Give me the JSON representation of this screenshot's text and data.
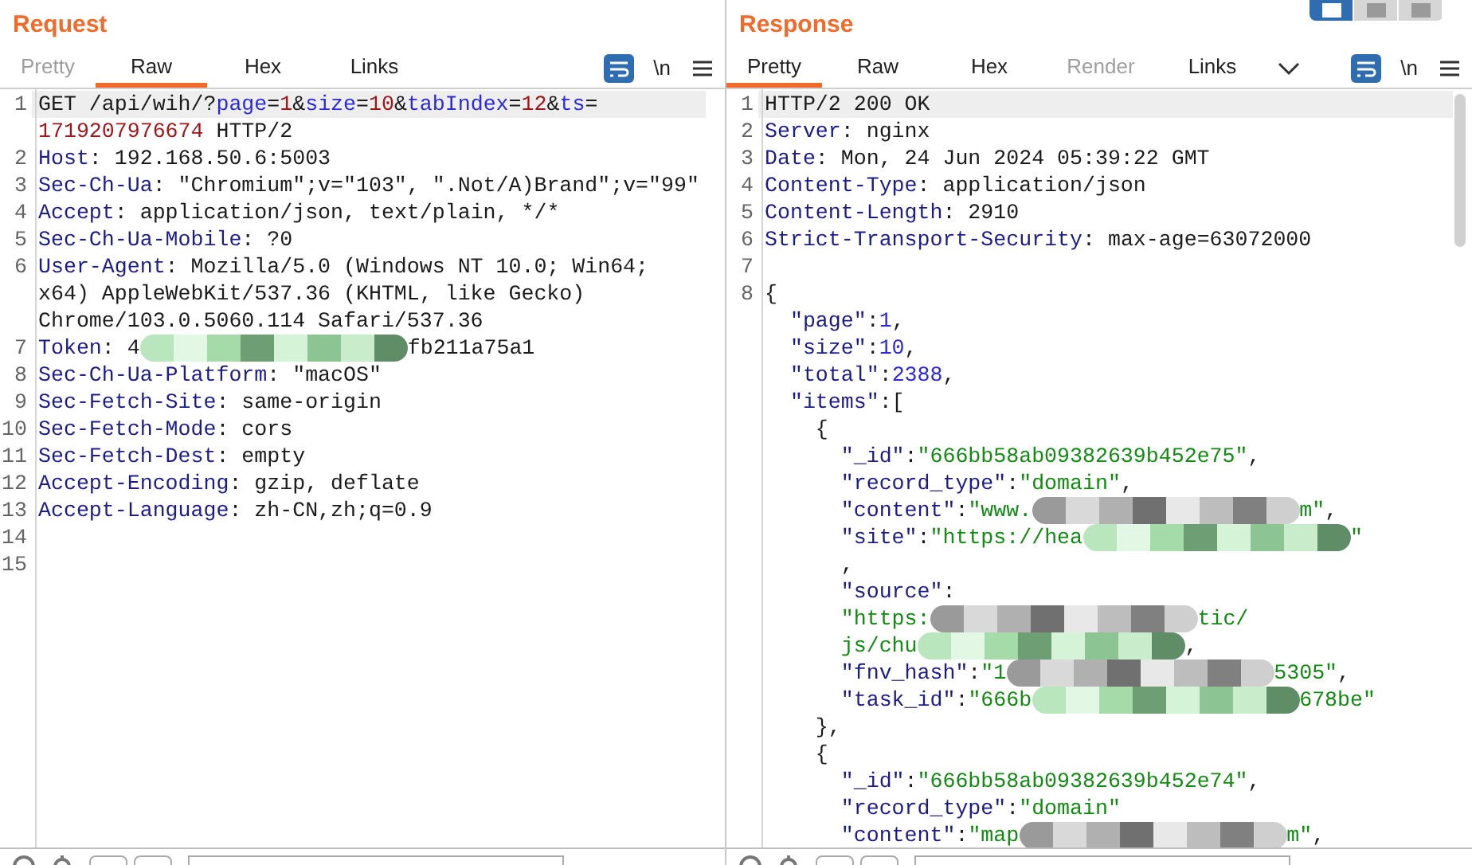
{
  "layout_buttons": [
    {
      "selected": true
    },
    {
      "selected": false
    },
    {
      "selected": false
    }
  ],
  "panes": [
    {
      "title": "Request",
      "tabs": [
        {
          "label": "Pretty",
          "selected": false,
          "disabled": true
        },
        {
          "label": "Raw",
          "selected": true,
          "disabled": false
        },
        {
          "label": "Hex",
          "selected": false,
          "disabled": false
        },
        {
          "label": "Links",
          "selected": false,
          "disabled": false
        }
      ],
      "more_tabs": false,
      "wrap_label": "\\n",
      "lines": [
        {
          "number": "1",
          "highlighted": true,
          "tokens": [
            {
              "kind": "plain",
              "text": "GET /api/wih/?"
            },
            {
              "kind": "param",
              "text": "page"
            },
            {
              "kind": "plain",
              "text": "="
            },
            {
              "kind": "num",
              "text": "1"
            },
            {
              "kind": "plain",
              "text": "&"
            },
            {
              "kind": "param",
              "text": "size"
            },
            {
              "kind": "plain",
              "text": "="
            },
            {
              "kind": "num",
              "text": "10"
            },
            {
              "kind": "plain",
              "text": "&"
            },
            {
              "kind": "param",
              "text": "tabIndex"
            },
            {
              "kind": "plain",
              "text": "="
            },
            {
              "kind": "num",
              "text": "12"
            },
            {
              "kind": "plain",
              "text": "&"
            },
            {
              "kind": "param",
              "text": "ts"
            },
            {
              "kind": "plain",
              "text": "="
            }
          ]
        },
        {
          "highlighted": false,
          "tokens": [
            {
              "kind": "num",
              "text": "1719207976674"
            },
            {
              "kind": "plain",
              "text": " HTTP/2"
            }
          ]
        },
        {
          "number": "2",
          "highlighted": false,
          "tokens": [
            {
              "kind": "header",
              "text": "Host"
            },
            {
              "kind": "plain",
              "text": ": 192.168.50.6:5003"
            }
          ]
        },
        {
          "number": "3",
          "highlighted": false,
          "tokens": [
            {
              "kind": "header",
              "text": "Sec-Ch-Ua"
            },
            {
              "kind": "plain",
              "text": ": \"Chromium\";v=\"103\", \".Not/A)Brand\";v=\"99\""
            }
          ]
        },
        {
          "number": "4",
          "highlighted": false,
          "tokens": [
            {
              "kind": "header",
              "text": "Accept"
            },
            {
              "kind": "plain",
              "text": ": application/json, text/plain, */*"
            }
          ]
        },
        {
          "number": "5",
          "highlighted": false,
          "tokens": [
            {
              "kind": "header",
              "text": "Sec-Ch-Ua-Mobile"
            },
            {
              "kind": "plain",
              "text": ": ?0"
            }
          ]
        },
        {
          "number": "6",
          "highlighted": false,
          "tokens": [
            {
              "kind": "header",
              "text": "User-Agent"
            },
            {
              "kind": "plain",
              "text": ": Mozilla/5.0 (Windows NT 10.0; Win64;"
            }
          ]
        },
        {
          "highlighted": false,
          "tokens": [
            {
              "kind": "plain",
              "text": "x64) AppleWebKit/537.36 (KHTML, like Gecko)"
            }
          ]
        },
        {
          "highlighted": false,
          "tokens": [
            {
              "kind": "plain",
              "text": "Chrome/103.0.5060.114 Safari/537.36"
            }
          ]
        },
        {
          "number": "7",
          "highlighted": false,
          "tokens": [
            {
              "kind": "header",
              "text": "Token"
            },
            {
              "kind": "plain",
              "text": ": 4"
            },
            {
              "kind": "redacted"
            },
            {
              "kind": "plain",
              "text": "fb211a75a1"
            }
          ]
        },
        {
          "number": "8",
          "highlighted": false,
          "tokens": [
            {
              "kind": "header",
              "text": "Sec-Ch-Ua-Platform"
            },
            {
              "kind": "plain",
              "text": ": \"macOS\""
            }
          ]
        },
        {
          "number": "9",
          "highlighted": false,
          "tokens": [
            {
              "kind": "header",
              "text": "Sec-Fetch-Site"
            },
            {
              "kind": "plain",
              "text": ": same-origin"
            }
          ]
        },
        {
          "number": "10",
          "highlighted": false,
          "tokens": [
            {
              "kind": "header",
              "text": "Sec-Fetch-Mode"
            },
            {
              "kind": "plain",
              "text": ": cors"
            }
          ]
        },
        {
          "number": "11",
          "highlighted": false,
          "tokens": [
            {
              "kind": "header",
              "text": "Sec-Fetch-Dest"
            },
            {
              "kind": "plain",
              "text": ": empty"
            }
          ]
        },
        {
          "number": "12",
          "highlighted": false,
          "tokens": [
            {
              "kind": "header",
              "text": "Accept-Encoding"
            },
            {
              "kind": "plain",
              "text": ": gzip, deflate"
            }
          ]
        },
        {
          "number": "13",
          "highlighted": false,
          "tokens": [
            {
              "kind": "header",
              "text": "Accept-Language"
            },
            {
              "kind": "plain",
              "text": ": zh-CN,zh;q=0.9"
            }
          ]
        },
        {
          "number": "14",
          "highlighted": false
        },
        {
          "number": "15",
          "highlighted": false
        }
      ]
    },
    {
      "title": "Response",
      "tabs": [
        {
          "label": "Pretty",
          "selected": true,
          "disabled": false
        },
        {
          "label": "Raw",
          "selected": false,
          "disabled": false
        },
        {
          "label": "Hex",
          "selected": false,
          "disabled": false
        },
        {
          "label": "Render",
          "selected": false,
          "disabled": true
        },
        {
          "label": "Links",
          "selected": false,
          "disabled": false
        }
      ],
      "more_tabs": true,
      "wrap_label": "\\n",
      "lines": [
        {
          "number": "1",
          "highlighted": true,
          "tokens": [
            {
              "kind": "plain",
              "text": "HTTP/2 200 OK"
            }
          ]
        },
        {
          "number": "2",
          "highlighted": false,
          "tokens": [
            {
              "kind": "header",
              "text": "Server"
            },
            {
              "kind": "plain",
              "text": ": nginx"
            }
          ]
        },
        {
          "number": "3",
          "highlighted": false,
          "tokens": [
            {
              "kind": "header",
              "text": "Date"
            },
            {
              "kind": "plain",
              "text": ": Mon, 24 Jun 2024 05:39:22 GMT"
            }
          ]
        },
        {
          "number": "4",
          "highlighted": false,
          "tokens": [
            {
              "kind": "header",
              "text": "Content-Type"
            },
            {
              "kind": "plain",
              "text": ": application/json"
            }
          ]
        },
        {
          "number": "5",
          "highlighted": false,
          "tokens": [
            {
              "kind": "header",
              "text": "Content-Length"
            },
            {
              "kind": "plain",
              "text": ": 2910"
            }
          ]
        },
        {
          "number": "6",
          "highlighted": false,
          "tokens": [
            {
              "kind": "header",
              "text": "Strict-Transport-Security"
            },
            {
              "kind": "plain",
              "text": ": max-age=63072000"
            }
          ]
        },
        {
          "number": "7",
          "highlighted": false
        },
        {
          "number": "8",
          "highlighted": false,
          "tokens": [
            {
              "kind": "plain",
              "text": "{"
            }
          ]
        },
        {
          "highlighted": false,
          "tokens": [
            {
              "kind": "jkey",
              "text": "  \"page\""
            },
            {
              "kind": "plain",
              "text": ":"
            },
            {
              "kind": "jnum",
              "text": "1"
            },
            {
              "kind": "plain",
              "text": ","
            }
          ]
        },
        {
          "highlighted": false,
          "tokens": [
            {
              "kind": "jkey",
              "text": "  \"size\""
            },
            {
              "kind": "plain",
              "text": ":"
            },
            {
              "kind": "jnum",
              "text": "10"
            },
            {
              "kind": "plain",
              "text": ","
            }
          ]
        },
        {
          "highlighted": false,
          "tokens": [
            {
              "kind": "jkey",
              "text": "  \"total\""
            },
            {
              "kind": "plain",
              "text": ":"
            },
            {
              "kind": "jnum",
              "text": "2388"
            },
            {
              "kind": "plain",
              "text": ","
            }
          ]
        },
        {
          "highlighted": false,
          "tokens": [
            {
              "kind": "jkey",
              "text": "  \"items\""
            },
            {
              "kind": "plain",
              "text": ":["
            }
          ]
        },
        {
          "highlighted": false,
          "tokens": [
            {
              "kind": "plain",
              "text": "    {"
            }
          ]
        },
        {
          "highlighted": false,
          "tokens": [
            {
              "kind": "jkey",
              "text": "      \"_id\""
            },
            {
              "kind": "plain",
              "text": ":"
            },
            {
              "kind": "jstr",
              "text": "\"666bb58ab09382639b452e75\""
            },
            {
              "kind": "plain",
              "text": ","
            }
          ]
        },
        {
          "highlighted": false,
          "tokens": [
            {
              "kind": "jkey",
              "text": "      \"record_type\""
            },
            {
              "kind": "plain",
              "text": ":"
            },
            {
              "kind": "jstr",
              "text": "\"domain\""
            },
            {
              "kind": "plain",
              "text": ","
            }
          ]
        },
        {
          "highlighted": false,
          "tokens": [
            {
              "kind": "jkey",
              "text": "      \"content\""
            },
            {
              "kind": "plain",
              "text": ":"
            },
            {
              "kind": "jstr",
              "text": "\"www."
            },
            {
              "kind": "redacted"
            },
            {
              "kind": "jstr",
              "text": "m\""
            },
            {
              "kind": "plain",
              "text": ","
            }
          ]
        },
        {
          "highlighted": false,
          "tokens": [
            {
              "kind": "jkey",
              "text": "      \"site\""
            },
            {
              "kind": "plain",
              "text": ":"
            },
            {
              "kind": "jstr",
              "text": "\"https://hea"
            },
            {
              "kind": "redacted"
            },
            {
              "kind": "jstr",
              "text": "\""
            }
          ]
        },
        {
          "highlighted": false,
          "tokens": [
            {
              "kind": "plain",
              "text": "      ,"
            }
          ]
        },
        {
          "highlighted": false,
          "tokens": [
            {
              "kind": "jkey",
              "text": "      \"source\""
            },
            {
              "kind": "plain",
              "text": ":"
            }
          ]
        },
        {
          "highlighted": false,
          "tokens": [
            {
              "kind": "jstr",
              "text": "      \"https:"
            },
            {
              "kind": "redacted"
            },
            {
              "kind": "jstr",
              "text": "tic/"
            }
          ]
        },
        {
          "highlighted": false,
          "tokens": [
            {
              "kind": "jstr",
              "text": "      js/chu"
            },
            {
              "kind": "redacted"
            },
            {
              "kind": "plain",
              "text": ","
            }
          ]
        },
        {
          "highlighted": false,
          "tokens": [
            {
              "kind": "jkey",
              "text": "      \"fnv_hash\""
            },
            {
              "kind": "plain",
              "text": ":"
            },
            {
              "kind": "jstr",
              "text": "\"1"
            },
            {
              "kind": "redacted"
            },
            {
              "kind": "jstr",
              "text": "5305\""
            },
            {
              "kind": "plain",
              "text": ","
            }
          ]
        },
        {
          "highlighted": false,
          "tokens": [
            {
              "kind": "jkey",
              "text": "      \"task_id\""
            },
            {
              "kind": "plain",
              "text": ":"
            },
            {
              "kind": "jstr",
              "text": "\"666b"
            },
            {
              "kind": "redacted"
            },
            {
              "kind": "jstr",
              "text": "678be\""
            }
          ]
        },
        {
          "highlighted": false,
          "tokens": [
            {
              "kind": "plain",
              "text": "    },"
            }
          ]
        },
        {
          "highlighted": false,
          "tokens": [
            {
              "kind": "plain",
              "text": "    {"
            }
          ]
        },
        {
          "highlighted": false,
          "tokens": [
            {
              "kind": "jkey",
              "text": "      \"_id\""
            },
            {
              "kind": "plain",
              "text": ":"
            },
            {
              "kind": "jstr",
              "text": "\"666bb58ab09382639b452e74\""
            },
            {
              "kind": "plain",
              "text": ","
            }
          ]
        },
        {
          "highlighted": false,
          "tokens": [
            {
              "kind": "jkey",
              "text": "      \"record_type\""
            },
            {
              "kind": "plain",
              "text": ":"
            },
            {
              "kind": "jstr",
              "text": "\"domain\""
            }
          ]
        },
        {
          "highlighted": false,
          "tokens": [
            {
              "kind": "jkey",
              "text": "      \"content\""
            },
            {
              "kind": "plain",
              "text": ":"
            },
            {
              "kind": "jstr",
              "text": "\"map"
            },
            {
              "kind": "redacted"
            },
            {
              "kind": "jstr",
              "text": "m\""
            },
            {
              "kind": "plain",
              "text": ","
            }
          ]
        }
      ]
    }
  ]
}
